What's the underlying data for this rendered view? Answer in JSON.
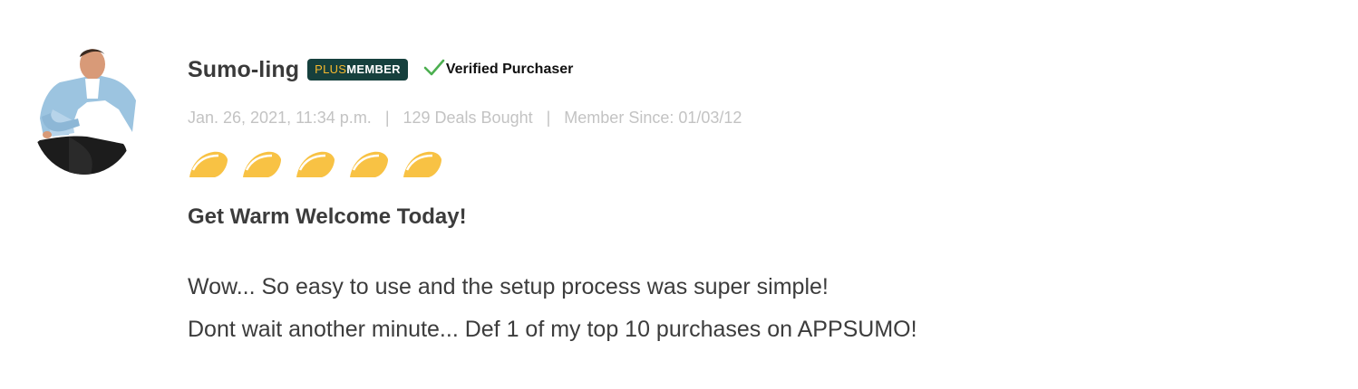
{
  "review": {
    "username": "Sumo-ling",
    "badge": {
      "plus": "PLUS",
      "member": "MEMBER"
    },
    "verified_label": "Verified Purchaser",
    "meta": {
      "date": "Jan. 26, 2021, 11:34 p.m.",
      "deals_bought": "129 Deals Bought",
      "member_since": "Member Since: 01/03/12"
    },
    "rating": {
      "value": 5,
      "max": 5,
      "icon": "taco-icon"
    },
    "title": "Get Warm Welcome Today!",
    "body_lines": [
      "Wow... So easy to use and the setup process was super simple!",
      "Dont wait another minute... Def 1 of my top 10 purchases on APPSUMO!"
    ]
  },
  "colors": {
    "badge_bg": "#16403d",
    "badge_plus": "#f5b82e",
    "verified_check": "#4caf50",
    "taco": "#f8c244",
    "meta_text": "#c3c3c3",
    "body_text": "#3c3c3c"
  }
}
